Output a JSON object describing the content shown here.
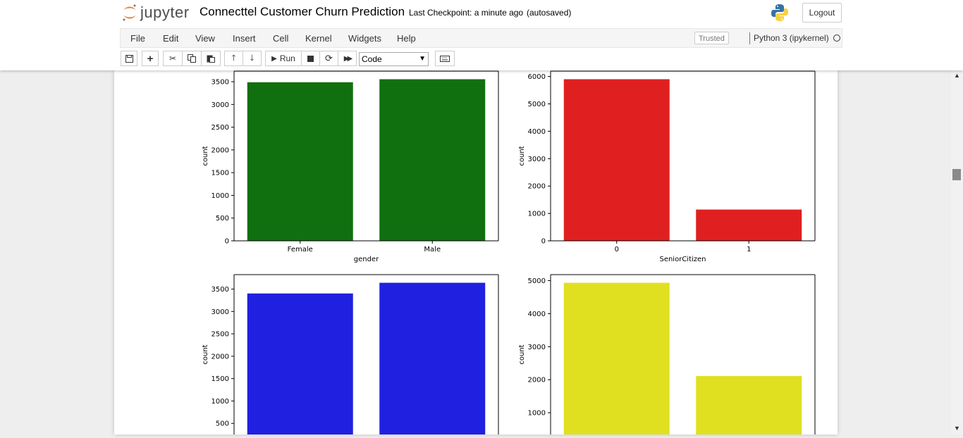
{
  "app": {
    "logo_text": "jupyter",
    "notebook_title": "Connecttel Customer Churn Prediction",
    "checkpoint": "Last Checkpoint: a minute ago",
    "autosave": "(autosaved)",
    "logout_label": "Logout"
  },
  "menu": {
    "items": [
      "File",
      "Edit",
      "View",
      "Insert",
      "Cell",
      "Kernel",
      "Widgets",
      "Help"
    ],
    "trusted": "Trusted",
    "kernel": "Python 3 (ipykernel)"
  },
  "toolbar": {
    "run_label": "Run",
    "cell_type": "Code",
    "icons": [
      "save-icon",
      "plus-icon",
      "scissors-icon",
      "copy-icon",
      "paste-icon",
      "arrow-up-icon",
      "arrow-down-icon",
      "play-icon",
      "stop-icon",
      "restart-icon",
      "fast-forward-icon",
      "keyboard-icon"
    ]
  },
  "colors": {
    "green": "#107010",
    "red": "#e02020",
    "blue": "#2020e0",
    "yellow": "#e0e020"
  },
  "chart_data": [
    {
      "type": "bar",
      "categories": [
        "Female",
        "Male"
      ],
      "values": [
        3488,
        3555
      ],
      "xlabel": "gender",
      "ylabel": "count",
      "ylim": [
        0,
        3733
      ],
      "yticks": [
        0,
        500,
        1000,
        1500,
        2000,
        2500,
        3000,
        3500
      ],
      "color": "#107010"
    },
    {
      "type": "bar",
      "categories": [
        "0",
        "1"
      ],
      "values": [
        5901,
        1142
      ],
      "xlabel": "SeniorCitizen",
      "ylabel": "count",
      "ylim": [
        0,
        6196
      ],
      "yticks": [
        0,
        1000,
        2000,
        3000,
        4000,
        5000,
        6000
      ],
      "color": "#e02020"
    },
    {
      "type": "bar",
      "categories": [
        "",
        ""
      ],
      "values": [
        3402,
        3641
      ],
      "xlabel": "",
      "ylabel": "count",
      "ylim": [
        0,
        3823
      ],
      "yticks": [
        500,
        1000,
        1500,
        2000,
        2500,
        3000,
        3500
      ],
      "color": "#2020e0"
    },
    {
      "type": "bar",
      "categories": [
        "",
        ""
      ],
      "values": [
        4933,
        2110
      ],
      "xlabel": "",
      "ylabel": "count",
      "ylim": [
        0,
        5180
      ],
      "yticks": [
        1000,
        2000,
        3000,
        4000,
        5000
      ],
      "color": "#e0e020"
    }
  ]
}
